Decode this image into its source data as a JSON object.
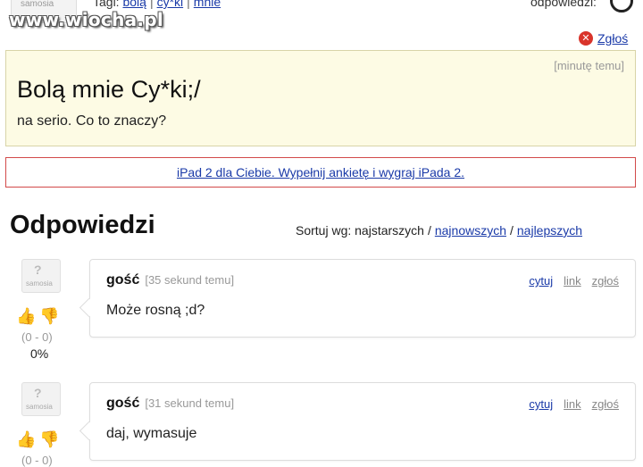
{
  "top": {
    "avatar_label": "samosia",
    "watermark": "www.wiocha.pl",
    "tags_prefix": "Tagi:",
    "tags": [
      "bolą",
      "cy*ki",
      "mnie"
    ],
    "answers_label": "odpowiedzi:"
  },
  "report": {
    "label": "Zgłoś",
    "icon": "close-circle-icon"
  },
  "question": {
    "time": "[minutę temu]",
    "title": "Bolą mnie Cy*ki;/",
    "body": "na serio. Co to znaczy?"
  },
  "ad": {
    "text": "iPad 2 dla Ciebie. Wypełnij ankietę i wygraj iPada 2."
  },
  "answers": {
    "heading": "Odpowiedzi",
    "sort_prefix": "Sortuj wg: najstarszych",
    "sort_options": [
      "najnowszych",
      "najlepszych"
    ],
    "items": [
      {
        "author": "gość",
        "time": "[35 sekund temu]",
        "text": "Może rosną ;d?",
        "score": "(0 - 0)",
        "percent": "0%",
        "actions": [
          "cytuj",
          "link",
          "zgłoś"
        ],
        "avatar_label": "samosia"
      },
      {
        "author": "gość",
        "time": "[31 sekund temu]",
        "text": "daj, wymasuje",
        "score": "(0 - 0)",
        "actions": [
          "cytuj",
          "link",
          "zgłoś"
        ],
        "avatar_label": "samosia"
      }
    ]
  },
  "colors": {
    "link": "#1a3aa8",
    "question_bg": "#fdfbe4",
    "ad_border": "#d24a4a",
    "report_icon": "#d9342b"
  }
}
